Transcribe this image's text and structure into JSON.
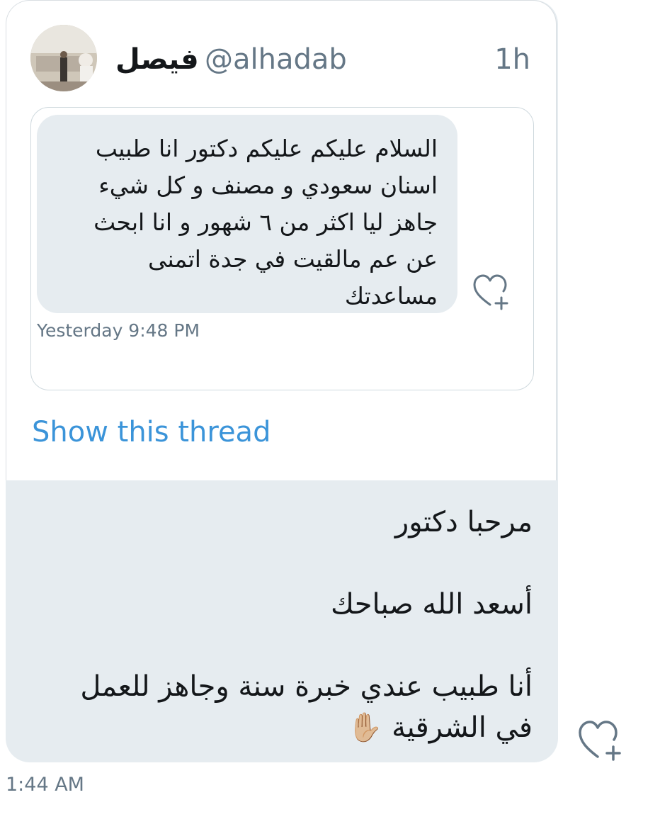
{
  "tweet": {
    "author_name": "فيصل",
    "handle": "@alhadab",
    "time": "1h",
    "quoted_message": {
      "text": "السلام عليكم عليكم دكتور انا طبيب اسنان سعودي و مصنف و كل شيء جاهز ليا اكثر من ٦ شهور و انا ابحث عن عم مالقيت في جدة اتمنى مساعدتك",
      "timestamp": "Yesterday 9:48 PM"
    },
    "show_thread_label": "Show this thread"
  },
  "reply": {
    "line1": "مرحبا دكتور",
    "line2": "أسعد الله صباحك",
    "line3": "أنا طبيب عندي خبرة سنة وجاهز للعمل في الشرقية",
    "emoji": "✋🏼"
  },
  "message_time": "1:44 AM",
  "icons": {
    "like_add": "heart-plus-icon",
    "avatar": "user-avatar"
  },
  "colors": {
    "link": "#3b94d9",
    "bubble": "#e6ecf0",
    "muted": "#657786",
    "text": "#14171a"
  }
}
